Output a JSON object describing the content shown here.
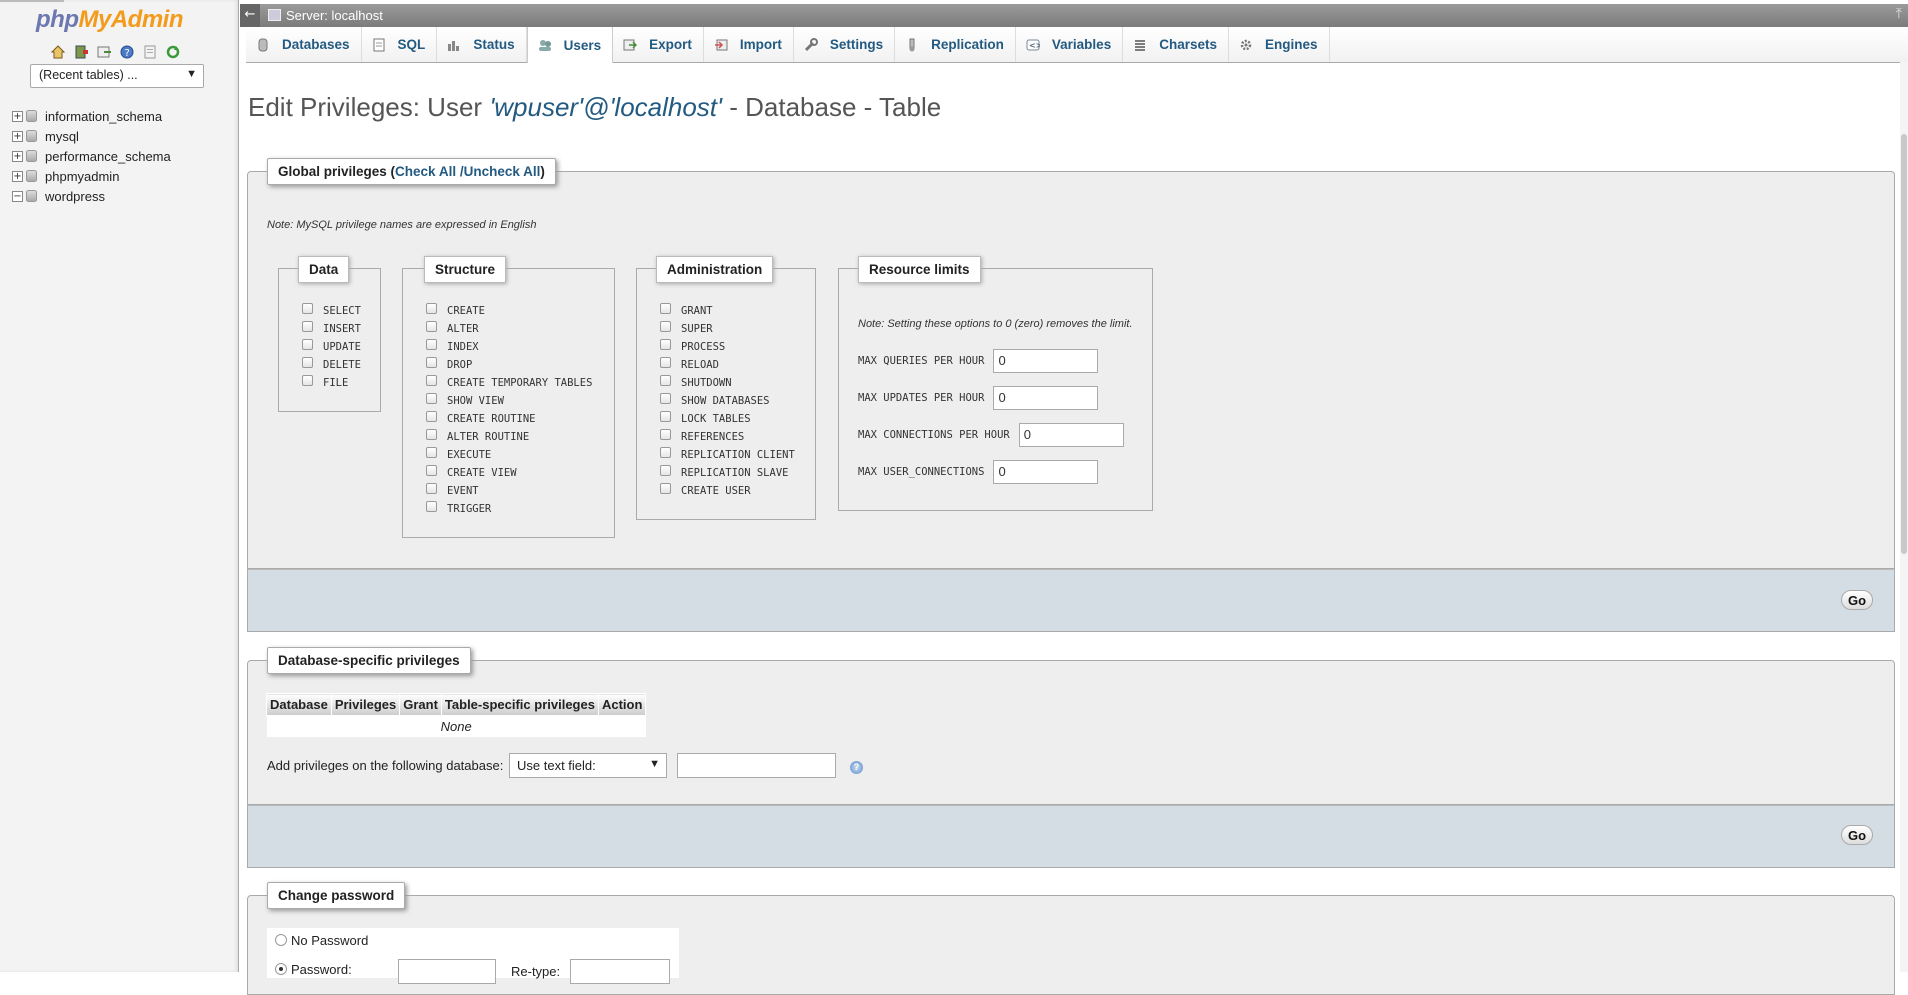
{
  "sidebar": {
    "logo_php": "php",
    "logo_myadmin": "MyAdmin",
    "nav_icons": [
      "home-icon",
      "logout-icon",
      "query-window-icon",
      "docs-icon",
      "mysql-docs-icon",
      "reload-icon"
    ],
    "recent_tables": "(Recent tables) ...",
    "databases": [
      {
        "name": "information_schema",
        "expander": "+"
      },
      {
        "name": "mysql",
        "expander": "+"
      },
      {
        "name": "performance_schema",
        "expander": "+"
      },
      {
        "name": "phpmyadmin",
        "expander": "+"
      },
      {
        "name": "wordpress",
        "expander": "−"
      }
    ]
  },
  "topbar": {
    "back": "←",
    "server": "Server: localhost",
    "close": "⤒"
  },
  "tabs": [
    {
      "label": "Databases",
      "icon": "databases-icon"
    },
    {
      "label": "SQL",
      "icon": "sql-icon"
    },
    {
      "label": "Status",
      "icon": "status-icon"
    },
    {
      "label": "Users",
      "icon": "users-icon",
      "active": true
    },
    {
      "label": "Export",
      "icon": "export-icon"
    },
    {
      "label": "Import",
      "icon": "import-icon"
    },
    {
      "label": "Settings",
      "icon": "settings-icon"
    },
    {
      "label": "Replication",
      "icon": "replication-icon"
    },
    {
      "label": "Variables",
      "icon": "variables-icon"
    },
    {
      "label": "Charsets",
      "icon": "charsets-icon"
    },
    {
      "label": "Engines",
      "icon": "engines-icon"
    }
  ],
  "title": {
    "prefix": "Edit Privileges: User ",
    "user": "'wpuser'@'localhost'",
    "suffix": " - Database - Table"
  },
  "global": {
    "legend": "Global privileges",
    "open_paren": " (",
    "check_all": "Check All",
    "sep": " /",
    "uncheck_all": "Uncheck All",
    "close_paren": ")",
    "note": "Note: MySQL privilege names are expressed in English",
    "data": {
      "legend": "Data",
      "privs": [
        "SELECT",
        "INSERT",
        "UPDATE",
        "DELETE",
        "FILE"
      ]
    },
    "structure": {
      "legend": "Structure",
      "privs": [
        "CREATE",
        "ALTER",
        "INDEX",
        "DROP",
        "CREATE TEMPORARY TABLES",
        "SHOW VIEW",
        "CREATE ROUTINE",
        "ALTER ROUTINE",
        "EXECUTE",
        "CREATE VIEW",
        "EVENT",
        "TRIGGER"
      ]
    },
    "administration": {
      "legend": "Administration",
      "privs": [
        "GRANT",
        "SUPER",
        "PROCESS",
        "RELOAD",
        "SHUTDOWN",
        "SHOW DATABASES",
        "LOCK TABLES",
        "REFERENCES",
        "REPLICATION CLIENT",
        "REPLICATION SLAVE",
        "CREATE USER"
      ]
    },
    "limits": {
      "legend": "Resource limits",
      "note": "Note: Setting these options to 0 (zero) removes the limit.",
      "rows": [
        {
          "label": "MAX QUERIES PER HOUR",
          "value": "0"
        },
        {
          "label": "MAX UPDATES PER HOUR",
          "value": "0"
        },
        {
          "label": "MAX CONNECTIONS PER HOUR",
          "value": "0"
        },
        {
          "label": "MAX USER_CONNECTIONS",
          "value": "0"
        }
      ]
    },
    "go": "Go"
  },
  "dbspecific": {
    "legend": "Database-specific privileges",
    "columns": [
      "Database",
      "Privileges",
      "Grant",
      "Table-specific privileges",
      "Action"
    ],
    "empty": "None",
    "add_label": "Add privileges on the following database:",
    "select_value": "Use text field:",
    "text_value": "",
    "go": "Go"
  },
  "password": {
    "legend": "Change password",
    "no_password": "No Password",
    "password_label": "Password:",
    "retype_label": "Re-type:"
  },
  "colors": {
    "link": "#235a81",
    "logo_php": "#6c78af",
    "logo_myadmin": "#f29b1c",
    "footer_bg": "#d5dde4"
  }
}
